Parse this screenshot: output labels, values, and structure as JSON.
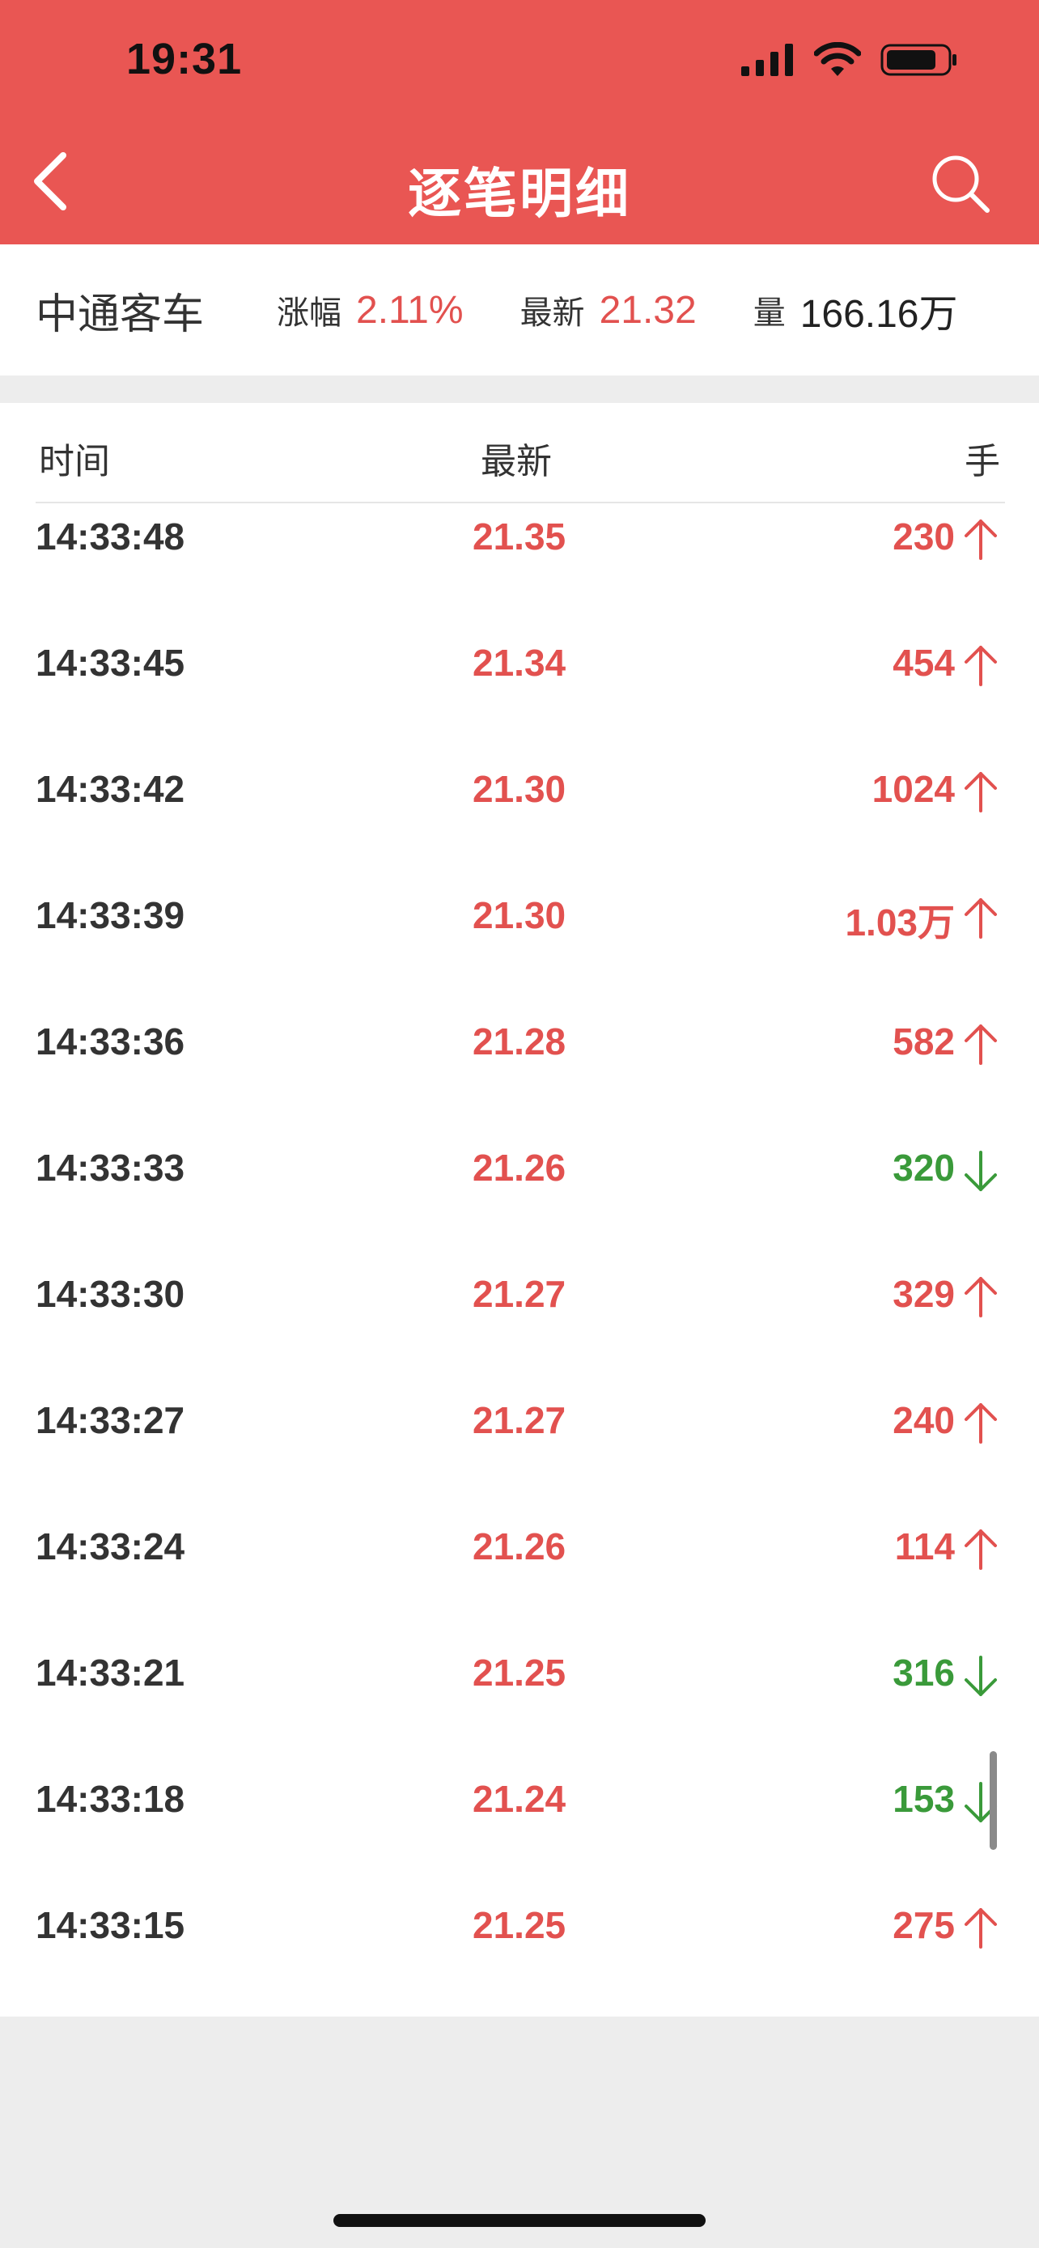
{
  "status": {
    "time": "19:31"
  },
  "nav": {
    "title": "逐笔明细"
  },
  "info": {
    "name": "中通客车",
    "change_label": "涨幅",
    "change_value": "2.11%",
    "latest_label": "最新",
    "latest_value": "21.32",
    "volume_label": "量",
    "volume_value": "166.16万"
  },
  "table": {
    "headers": {
      "time": "时间",
      "price": "最新",
      "volume": "手"
    },
    "rows": [
      {
        "time": "14:33:48",
        "price": "21.35",
        "volume": "230",
        "direction": "up"
      },
      {
        "time": "14:33:45",
        "price": "21.34",
        "volume": "454",
        "direction": "up"
      },
      {
        "time": "14:33:42",
        "price": "21.30",
        "volume": "1024",
        "direction": "up"
      },
      {
        "time": "14:33:39",
        "price": "21.30",
        "volume": "1.03万",
        "direction": "up"
      },
      {
        "time": "14:33:36",
        "price": "21.28",
        "volume": "582",
        "direction": "up"
      },
      {
        "time": "14:33:33",
        "price": "21.26",
        "volume": "320",
        "direction": "down"
      },
      {
        "time": "14:33:30",
        "price": "21.27",
        "volume": "329",
        "direction": "up"
      },
      {
        "time": "14:33:27",
        "price": "21.27",
        "volume": "240",
        "direction": "up"
      },
      {
        "time": "14:33:24",
        "price": "21.26",
        "volume": "114",
        "direction": "up"
      },
      {
        "time": "14:33:21",
        "price": "21.25",
        "volume": "316",
        "direction": "down"
      },
      {
        "time": "14:33:18",
        "price": "21.24",
        "volume": "153",
        "direction": "down"
      },
      {
        "time": "14:33:15",
        "price": "21.25",
        "volume": "275",
        "direction": "up"
      }
    ]
  },
  "colors": {
    "header_bg": "#e95653",
    "up": "#e2514f",
    "down": "#3a9a3a"
  },
  "icons": {
    "back": "chevron-left-icon",
    "search": "search-icon",
    "up": "arrow-up-icon",
    "down": "arrow-down-icon"
  }
}
